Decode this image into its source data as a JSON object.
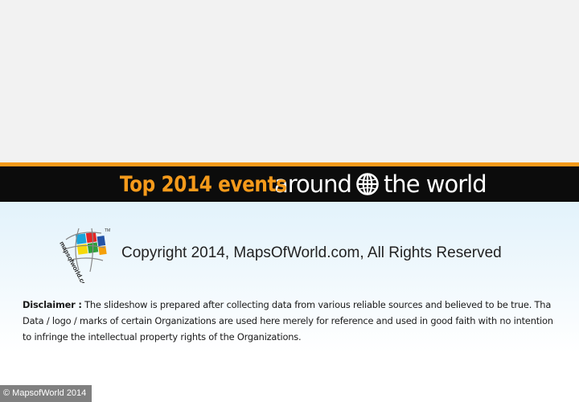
{
  "banner": {
    "title_bold": "Top 2014 events",
    "title_light_1": "around",
    "title_light_2": "the world",
    "globe_icon": "globe-icon",
    "accent_color": "#f59a1b",
    "bar_color": "#0c0c0c"
  },
  "logo": {
    "text": "mapsofworld.com",
    "tm": "TM",
    "icon": "mapsofworld-logo"
  },
  "copyright": "Copyright 2014, MapsOfWorld.com, All Rights Reserved",
  "disclaimer": {
    "label": "Disclaimer :",
    "text": "The slideshow is prepared after collecting data from various reliable sources and believed to be true. Tha Data / logo / marks of certain Organizations are used here merely for reference and used in good faith with no intention to infringe the intellectual property rights of the Organizations."
  },
  "footer": {
    "badge": "© MapsofWorld 2014"
  }
}
